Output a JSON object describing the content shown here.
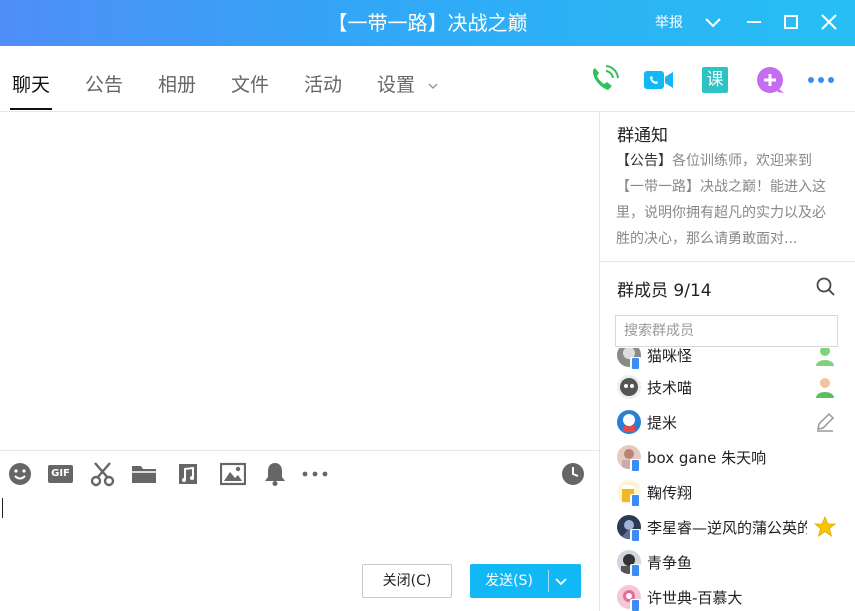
{
  "window": {
    "title": "【一带一路】决战之巅",
    "report_label": "举报"
  },
  "tabs": [
    {
      "label": "聊天",
      "active": true
    },
    {
      "label": "公告"
    },
    {
      "label": "相册"
    },
    {
      "label": "文件"
    },
    {
      "label": "活动"
    },
    {
      "label": "设置"
    }
  ],
  "top_icons": [
    "phone-call-icon",
    "video-call-icon",
    "course-icon",
    "add-app-icon",
    "more-icon"
  ],
  "top_icon_colors": {
    "green": "#2fc25b",
    "blue": "#12b7f5",
    "purple": "#c66cf2",
    "gray_blue": "#3b8cf4"
  },
  "course_icon_text": "课",
  "toolbar_icons": [
    "emoji-icon",
    "gif-icon",
    "screenshot-scissors-icon",
    "folder-icon",
    "music-icon",
    "image-icon",
    "bell-icon",
    "more-icon",
    "history-clock-icon"
  ],
  "gif_label": "GIF",
  "buttons": {
    "close_label": "关闭(C)",
    "send_label": "发送(S)"
  },
  "notice": {
    "title": "群通知",
    "tag": "【公告】",
    "text": "各位训练师，欢迎来到【一带一路】决战之巅！能进入这里，说明你拥有超凡的实力以及必胜的决心，那么请勇敢面对..."
  },
  "members": {
    "title": "群成员 9/14",
    "search_placeholder": "搜索群成员",
    "list": [
      {
        "name": "猫咪怪",
        "badge": "member-icon"
      },
      {
        "name": "技术喵",
        "badge": "admin-person-icon"
      },
      {
        "name": "提米",
        "badge": "edit-pencil-icon"
      },
      {
        "name": "box gane 朱天响",
        "badge": ""
      },
      {
        "name": "鞠传翔",
        "badge": ""
      },
      {
        "name": "李星睿—逆风的蒲公英的",
        "badge": "star-icon"
      },
      {
        "name": "青争鱼",
        "badge": ""
      },
      {
        "name": "许世典-百慕大",
        "badge": ""
      }
    ]
  }
}
